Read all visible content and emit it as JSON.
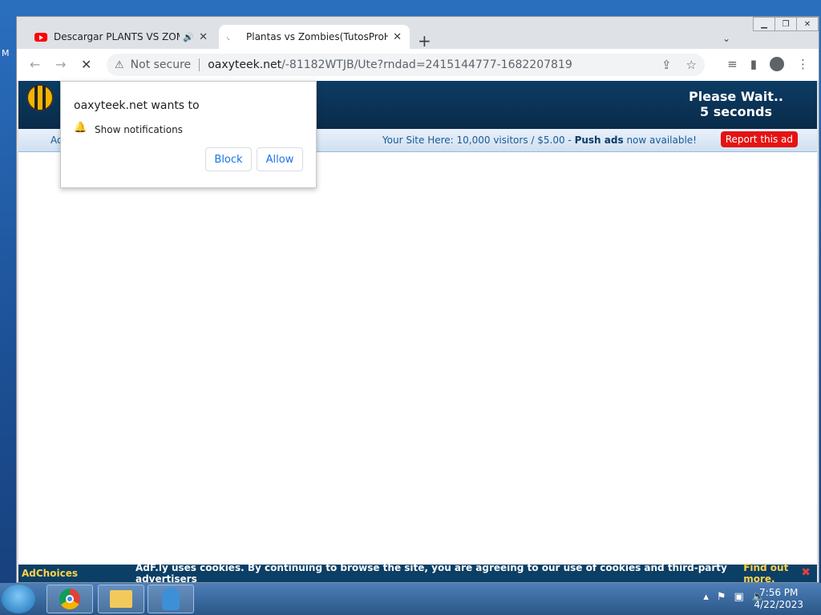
{
  "browser": {
    "tabs": [
      {
        "label": "Descargar PLANTS VS ZOMBIES",
        "active": false,
        "playing_audio": true
      },
      {
        "label": "Plantas vs Zombies(TutosProHD)",
        "active": true
      }
    ],
    "url": {
      "security": "Not secure",
      "host": "oaxyteek.net",
      "path": "/-81182WTJB/Ute?rndad=2415144777-1682207819"
    }
  },
  "page": {
    "please_wait_line1": "Please Wait..",
    "please_wait_line2": "5 seconds",
    "bar_left": "Ad",
    "bar_right_prefix": "Your Site Here: 10,000 visitors / $5.00 -",
    "bar_right_bold": "Push ads",
    "bar_right_suffix": "now available!",
    "report_label": "Report this ad"
  },
  "notification": {
    "title": "oaxyteek.net wants to",
    "permission": "Show notifications",
    "block_label": "Block",
    "allow_label": "Allow"
  },
  "cookie_bar": {
    "adchoices": "AdChoices",
    "text": "AdF.ly uses cookies. By continuing to browse the site, you are agreeing to our use of cookies and third-party advertisers",
    "link": "Find out more.",
    "close": "✖"
  },
  "taskbar": {
    "time": "7:56 PM",
    "date": "4/22/2023"
  },
  "desktop_edge": "M"
}
